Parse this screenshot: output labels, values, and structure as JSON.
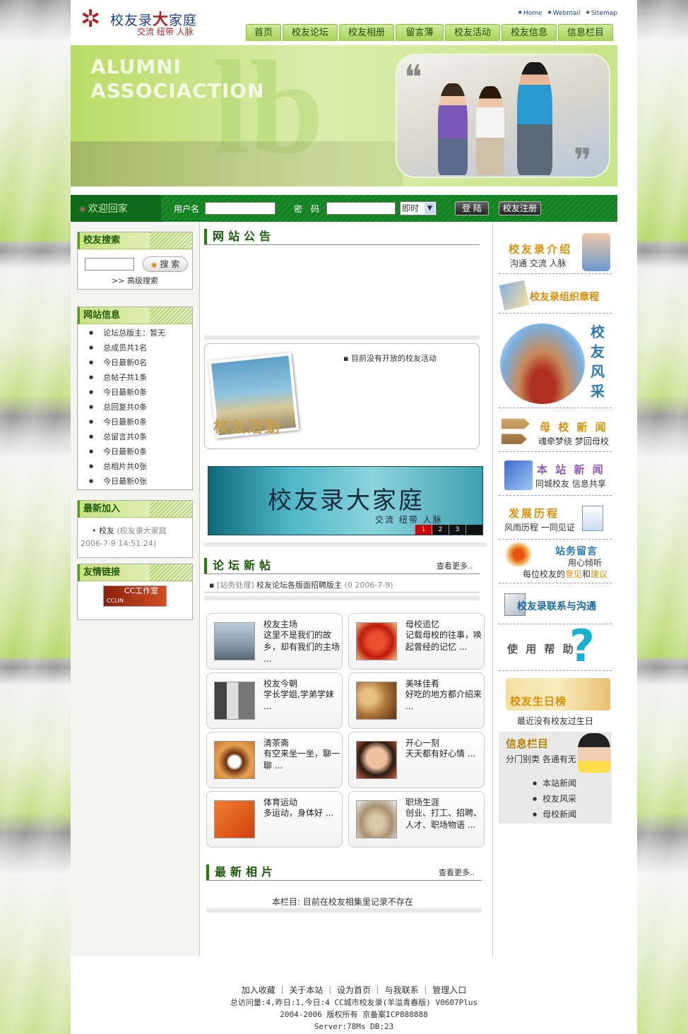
{
  "header": {
    "logo_title_a": "校友录",
    "logo_title_b": "大",
    "logo_title_c": "家庭",
    "logo_slogan": "交流 纽带 人脉",
    "top_links": [
      "Home",
      "Webmail",
      "Sitemap"
    ],
    "nav": [
      "首页",
      "校友论坛",
      "校友相册",
      "留言薄",
      "校友活动",
      "校友信息",
      "信息栏目"
    ]
  },
  "banner": {
    "line1": "ALUMNI",
    "line2": "ASSOCIACTION"
  },
  "login": {
    "welcome": "欢迎回家",
    "username_label": "用户名",
    "password_label": "密　码",
    "expire_select": "即时",
    "login_button": "登 陆",
    "register_button": "校友注册"
  },
  "left": {
    "search_title": "校友搜索",
    "search_button": "搜 索",
    "advanced_search": ">> 高级搜索",
    "site_info_title": "网站信息",
    "stats": [
      "论坛总版主：暂无",
      "总成员共1名",
      "今日最新0名",
      "总帖子共1条",
      "今日最新0条",
      "总回复共0条",
      "今日最新0条",
      "总留言共0条",
      "今日最新0条",
      "总相片共0张",
      "今日最新0张"
    ],
    "new_join_title": "最新加入",
    "new_member_name": "校友",
    "new_member_info": "(校友录大家庭",
    "new_member_date": "2006-7-9 14:51:24)",
    "links_title": "友情链接",
    "cc_logo_text": "CC工作室",
    "cc_logo_sub": "CCLIN"
  },
  "center": {
    "notice_title": "网站公告",
    "activity_label": "校友活動",
    "activity_text": "目前没有开放的校友活动",
    "ad_title": "校友录大家庭",
    "ad_sub": "交流  纽带  人脉",
    "ad_pages": [
      "1",
      "2",
      "3",
      ""
    ],
    "forum_title": "论坛新帖",
    "forum_more": "查看更多..",
    "post_cat": "[站务处理]",
    "post_title": "校友论坛各版面招聘版主",
    "post_date": "(0 2006-7-9)",
    "cards": [
      {
        "title": "校友主场",
        "desc": "这里不是我们的故乡，却有我们的主场 ...",
        "color": "#7a8aa8"
      },
      {
        "title": "母校追忆",
        "desc": "记载母校的往事，唤起曾经的记忆 ...",
        "color": "#d2361a"
      },
      {
        "title": "校友今朝",
        "desc": "学长学姐,学弟学妹 ...",
        "color": "#8a8a8a"
      },
      {
        "title": "美味佳肴",
        "desc": "好吃的地方都介绍来 ...",
        "color": "#b07838"
      },
      {
        "title": "清茶斋",
        "desc": "有空来坐一坐，聊一聊 ...",
        "color": "#c87830"
      },
      {
        "title": "开心一刻",
        "desc": "天天都有好心情 ...",
        "color": "#c86040"
      },
      {
        "title": "体育运动",
        "desc": "多运动，身体好 ...",
        "color": "#e05010"
      },
      {
        "title": "职场生涯",
        "desc": "创业、打工、招聘、人才、职场物语 ...",
        "color": "#a89070"
      }
    ],
    "photos_title": "最新相片",
    "photos_more": "查看更多..",
    "photos_empty": "本栏目: 目前在校友相集里记录不存在"
  },
  "right": {
    "intro_title": "校友录介绍",
    "intro_sub": "沟通 交流 人脉",
    "charter_title": "校友录组织章程",
    "style_title": "校友风采",
    "news_title": "母 校 新 闻",
    "news_sub": "魂牵梦绕 梦回母校",
    "site_news_title": "本 站 新 闻",
    "site_news_sub": "同城校友 信息共享",
    "history_title": "发展历程",
    "history_sub": "风雨历程 一同见证",
    "msg_title": "站务留言",
    "msg_sub": "用心倾听",
    "msg_sub2_a": "每位校友的",
    "msg_sub2_b": "意见",
    "msg_sub2_c": "和",
    "msg_sub2_d": "建议",
    "contact_title": "校友录联系与沟通",
    "help_title": "使 用 帮 助",
    "birthday_title": "校友生日榜",
    "birthday_text": "最近没有校友过生日",
    "info_title": "信息栏目",
    "info_sub": "分门别类 各通有无",
    "info_items": [
      "本站新闻",
      "校友风采",
      "母校新闻"
    ]
  },
  "footer": {
    "links": "加入收藏 ｜ 关于本站 ｜ 设为首页 ｜ 与我联系 ｜ 管理入口",
    "stats": "总访问量:4,昨日:1,今日:4 CC城市校友录(羊溢青春版) V0607Plus",
    "copyright": "2004-2006 版权所有 京备案ICP888888",
    "server": "Server:78Ms  DB:23"
  }
}
